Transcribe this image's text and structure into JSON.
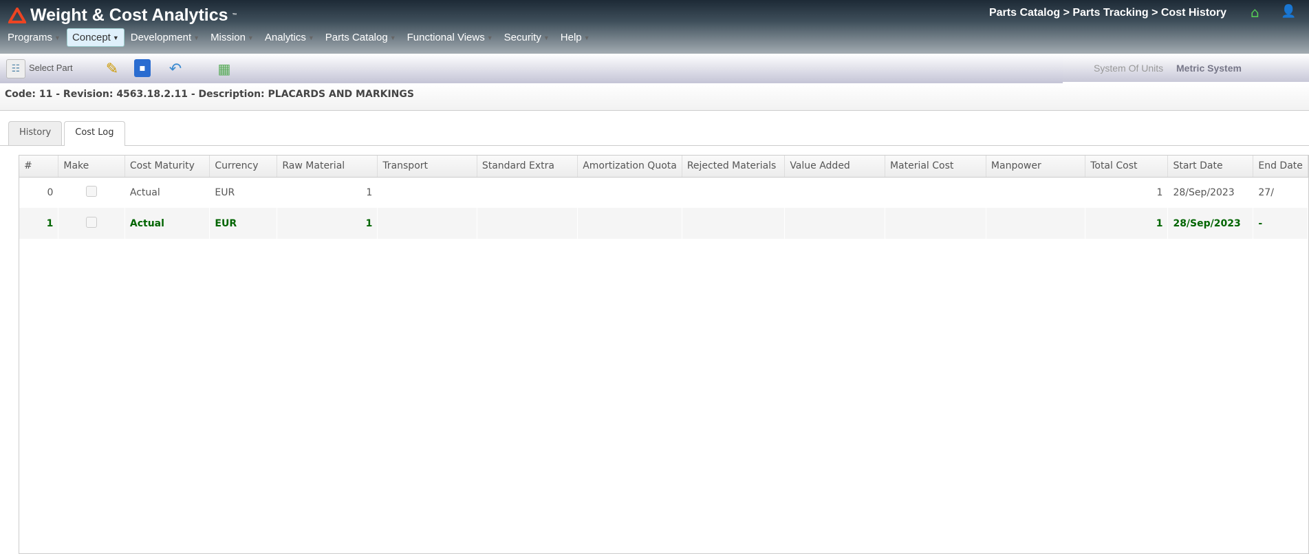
{
  "app": {
    "title": "Weight & Cost Analytics",
    "tm": "™"
  },
  "breadcrumb": "Parts Catalog > Parts Tracking > Cost History",
  "nav": [
    {
      "label": "Programs"
    },
    {
      "label": "Concept"
    },
    {
      "label": "Development"
    },
    {
      "label": "Mission"
    },
    {
      "label": "Analytics"
    },
    {
      "label": "Parts Catalog"
    },
    {
      "label": "Functional Views"
    },
    {
      "label": "Security"
    },
    {
      "label": "Help"
    }
  ],
  "toolbar": {
    "select_part": "Select Part",
    "units_label": "System Of Units",
    "units_value": "Metric System"
  },
  "part_info": "Code: 11 - Revision: 4563.18.2.11 - Description: PLACARDS AND MARKINGS",
  "tabs": [
    {
      "label": "History"
    },
    {
      "label": "Cost Log"
    }
  ],
  "table": {
    "columns": [
      "#",
      "Make",
      "Cost Maturity",
      "Currency",
      "Raw Material",
      "Transport",
      "Standard Extra",
      "Amortization Quota",
      "Rejected Materials",
      "Value Added",
      "Material Cost",
      "Manpower",
      "Total Cost",
      "Start Date",
      "End Date"
    ],
    "rows": [
      {
        "num": "0",
        "maturity": "Actual",
        "currency": "EUR",
        "raw": "1",
        "total": "1",
        "start": "28/Sep/2023",
        "end": "27/"
      },
      {
        "num": "1",
        "maturity": "Actual",
        "currency": "EUR",
        "raw": "1",
        "total": "1",
        "start": "28/Sep/2023",
        "end": "-"
      }
    ]
  }
}
